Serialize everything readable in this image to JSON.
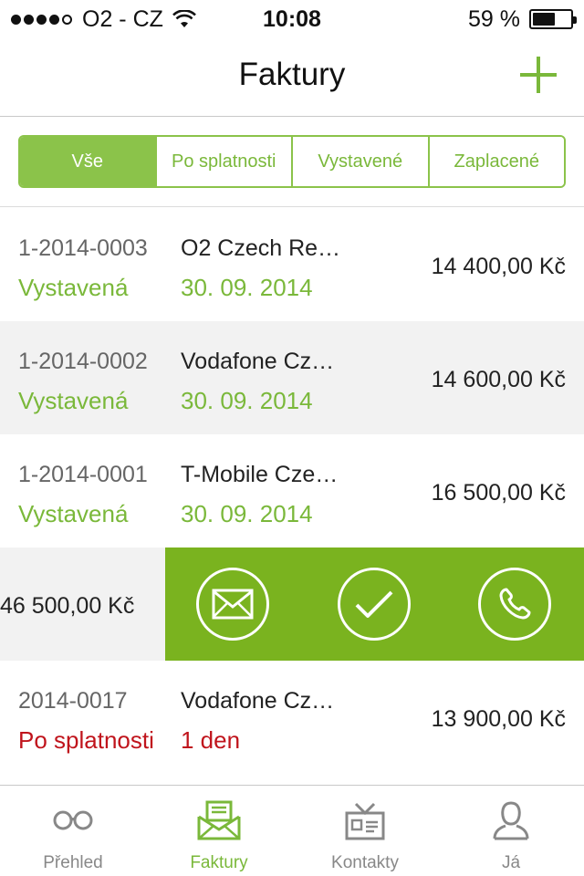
{
  "status_bar": {
    "carrier": "O2 - CZ",
    "time": "10:08",
    "battery": "59 %",
    "battery_level": 0.59
  },
  "nav": {
    "title": "Faktury"
  },
  "filters": [
    {
      "label": "Vše",
      "active": true
    },
    {
      "label": "Po splatnosti",
      "active": false
    },
    {
      "label": "Vystavené",
      "active": false
    },
    {
      "label": "Zaplacené",
      "active": false
    }
  ],
  "invoices": [
    {
      "number": "1-2014-0003",
      "company": "O2 Czech Re…",
      "status": "Vystavená",
      "date": "30. 09. 2014",
      "amount": "14 400,00 Kč"
    },
    {
      "number": "1-2014-0002",
      "company": "Vodafone Cz…",
      "status": "Vystavená",
      "date": "30. 09. 2014",
      "amount": "14 600,00 Kč"
    },
    {
      "number": "1-2014-0001",
      "company": "T-Mobile Cze…",
      "status": "Vystavená",
      "date": "30. 09. 2014",
      "amount": "16 500,00 Kč"
    },
    {
      "amount": "46 500,00 Kč"
    },
    {
      "number": "2014-0017",
      "company": "Vodafone Cz…",
      "status": "Po splatnosti",
      "date": "1 den",
      "amount": "13 900,00 Kč"
    }
  ],
  "tabs": [
    {
      "label": "Přehled",
      "icon": "glasses-icon",
      "active": false
    },
    {
      "label": "Faktury",
      "icon": "envelope-invoice-icon",
      "active": true
    },
    {
      "label": "Kontakty",
      "icon": "contact-card-icon",
      "active": false
    },
    {
      "label": "Já",
      "icon": "person-icon",
      "active": false
    }
  ],
  "colors": {
    "accent": "#8bc34a",
    "swipe_action_bg": "#7ab31f",
    "overdue": "#c0141c"
  }
}
